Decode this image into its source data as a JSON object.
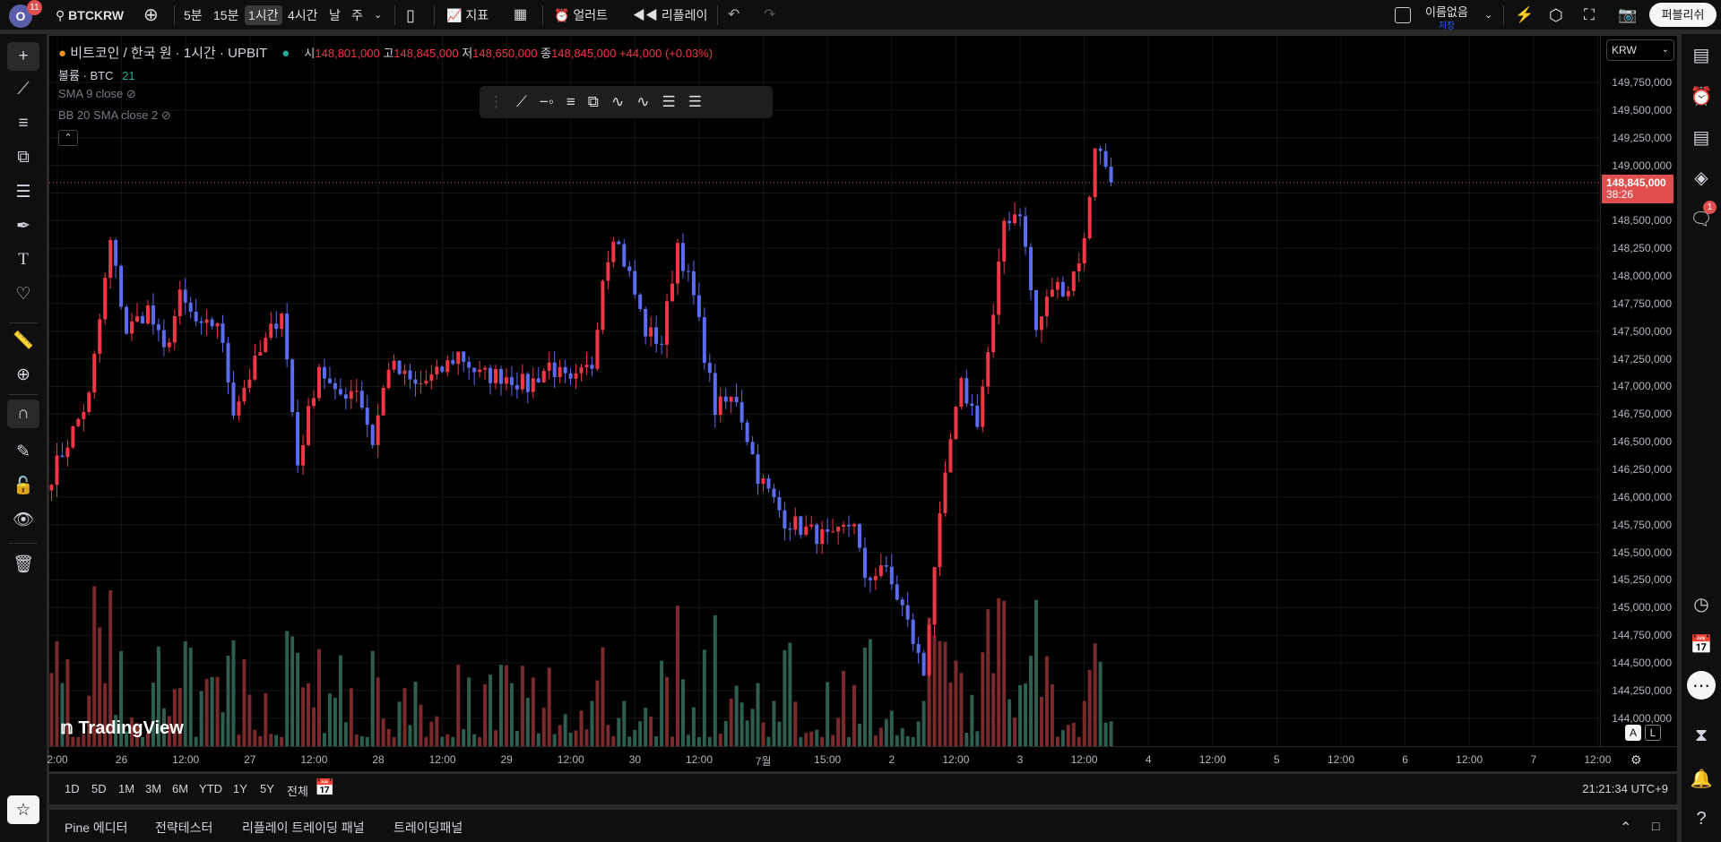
{
  "topbar": {
    "avatar_letter": "O",
    "notif_count": "11",
    "symbol": "BTCKRW",
    "intervals": [
      "5분",
      "15분",
      "1시간",
      "4시간",
      "날",
      "주"
    ],
    "active_interval": "1시간",
    "indicators_label": "지표",
    "alert_label": "얼러트",
    "replay_label": "리플레이",
    "layout_name": "이름없음",
    "save_status": "저장",
    "publish_label": "퍼블리쉬"
  },
  "legend": {
    "title": "비트코인 / 한국 원 · 1시간 · UPBIT",
    "o_label": "시",
    "o": "148,801,000",
    "h_label": "고",
    "h": "148,845,000",
    "l_label": "저",
    "l": "148,650,000",
    "c_label": "종",
    "c": "148,845,000",
    "change": "+44,000 (+0.03%)",
    "volume_label": "볼륨 · BTC",
    "volume_value": "21",
    "sma": "SMA 9 close",
    "bb": "BB 20 SMA close 2"
  },
  "colors": {
    "up": "#f23645",
    "down": "#5b6cf0",
    "vol_up": "#7a2a2a",
    "vol_down": "#2e5e50",
    "price_tag": "#e04e4e"
  },
  "price_axis": {
    "currency": "KRW",
    "labels": [
      "149,750,000",
      "149,500,000",
      "149,250,000",
      "149,000,000",
      "148,750,000",
      "148,500,000",
      "148,250,000",
      "148,000,000",
      "147,750,000",
      "147,500,000",
      "147,250,000",
      "147,000,000",
      "146,750,000",
      "146,500,000",
      "146,250,000",
      "146,000,000",
      "145,750,000",
      "145,500,000",
      "145,250,000",
      "145,000,000",
      "144,750,000",
      "144,500,000",
      "144,250,000",
      "144,000,000"
    ],
    "current_price": "148,845,000",
    "countdown": "38:26"
  },
  "time_axis": {
    "labels": [
      "2:00",
      "26",
      "12:00",
      "27",
      "12:00",
      "28",
      "12:00",
      "29",
      "12:00",
      "30",
      "12:00",
      "7월",
      "15:00",
      "2",
      "12:00",
      "3",
      "12:00",
      "4",
      "12:00",
      "5",
      "12:00",
      "6",
      "12:00",
      "7",
      "12:00"
    ]
  },
  "range_bar": {
    "ranges": [
      "1D",
      "5D",
      "1M",
      "3M",
      "6M",
      "YTD",
      "1Y",
      "5Y",
      "전체"
    ],
    "clock": "21:21:34 UTC+9"
  },
  "bottom_panel": {
    "tabs": [
      "Pine 에디터",
      "전략테스터",
      "리플레이 트레이딩 패널",
      "트레이딩패널"
    ]
  },
  "scale_buttons": {
    "auto": "A",
    "log": "L"
  },
  "watermark": "TradingView",
  "chat_badge": "1",
  "chart_data": {
    "type": "candlestick",
    "interval": "1h",
    "anchors": [
      [
        0,
        146.2
      ],
      [
        7,
        146.9
      ],
      [
        11,
        148.3
      ],
      [
        14,
        147.5
      ],
      [
        18,
        147.7
      ],
      [
        21,
        147.3
      ],
      [
        24,
        147.8
      ],
      [
        28,
        147.5
      ],
      [
        31,
        147.6
      ],
      [
        34,
        146.8
      ],
      [
        38,
        147.2
      ],
      [
        43,
        147.7
      ],
      [
        46,
        146.3
      ],
      [
        50,
        147.2
      ],
      [
        53,
        146.9
      ],
      [
        57,
        147.0
      ],
      [
        60,
        146.5
      ],
      [
        63,
        147.2
      ],
      [
        68,
        147.0
      ],
      [
        72,
        147.1
      ],
      [
        76,
        147.3
      ],
      [
        80,
        147.1
      ],
      [
        85,
        147.1
      ],
      [
        89,
        147.0
      ],
      [
        93,
        147.2
      ],
      [
        97,
        147.0
      ],
      [
        101,
        147.2
      ],
      [
        103,
        148.0
      ],
      [
        105,
        148.4
      ],
      [
        108,
        148.0
      ],
      [
        111,
        147.5
      ],
      [
        114,
        147.4
      ],
      [
        117,
        148.3
      ],
      [
        120,
        147.8
      ],
      [
        124,
        146.8
      ],
      [
        128,
        146.9
      ],
      [
        132,
        146.2
      ],
      [
        137,
        145.8
      ],
      [
        141,
        145.7
      ],
      [
        146,
        145.6
      ],
      [
        150,
        145.8
      ],
      [
        152,
        145.2
      ],
      [
        155,
        145.4
      ],
      [
        159,
        145.0
      ],
      [
        163,
        144.4
      ],
      [
        165,
        145.4
      ],
      [
        168,
        146.5
      ],
      [
        170,
        147.0
      ],
      [
        173,
        146.7
      ],
      [
        176,
        147.6
      ],
      [
        178,
        148.5
      ],
      [
        181,
        148.6
      ],
      [
        184,
        147.5
      ],
      [
        187,
        147.9
      ],
      [
        190,
        147.9
      ],
      [
        193,
        148.3
      ],
      [
        195,
        149.2
      ],
      [
        197,
        149.0
      ],
      [
        198,
        148.845
      ]
    ],
    "price_unit": "million KRW"
  }
}
